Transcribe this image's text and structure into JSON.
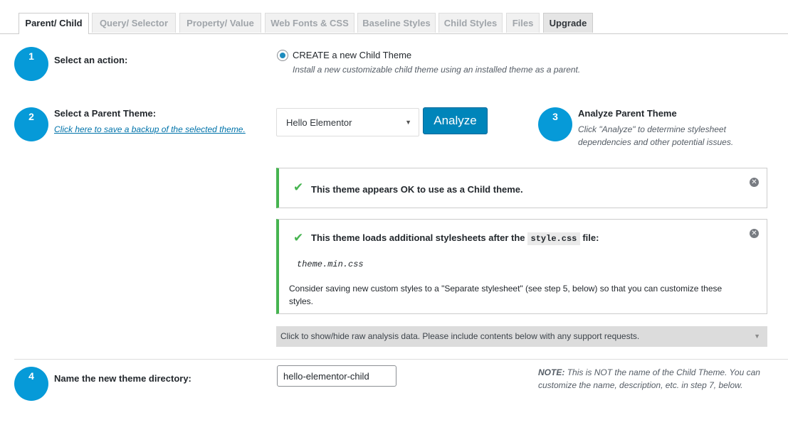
{
  "tabs": [
    {
      "label": "Parent/ Child",
      "active": true
    },
    {
      "label": "Query/ Selector"
    },
    {
      "label": "Property/ Value"
    },
    {
      "label": "Web Fonts & CSS"
    },
    {
      "label": "Baseline Styles"
    },
    {
      "label": "Child Styles"
    },
    {
      "label": "Files"
    },
    {
      "label": "Upgrade"
    }
  ],
  "step1": {
    "number": "1",
    "label": "Select an action:",
    "option_label": "CREATE a new Child Theme",
    "option_desc": "Install a new customizable child theme using an installed theme as a parent."
  },
  "step2": {
    "number": "2",
    "label": "Select a Parent Theme:",
    "backup_link": "Click here to save a backup of the selected theme.",
    "selected_theme": "Hello Elementor",
    "analyze_button": "Analyze"
  },
  "step3": {
    "number": "3",
    "label": "Analyze Parent Theme",
    "desc": "Click \"Analyze\" to determine stylesheet dependencies and other potential issues."
  },
  "notice1": {
    "text": "This theme appears OK to use as a Child theme."
  },
  "notice2": {
    "text_before": "This theme loads additional stylesheets after the",
    "code": "style.css",
    "text_after": "file:",
    "file": "theme.min.css",
    "advice": "Consider saving new custom styles to a \"Separate stylesheet\" (see step 5, below) so that you can customize these styles."
  },
  "raw_toggle": "Click to show/hide raw analysis data. Please include contents below with any support requests.",
  "step4": {
    "number": "4",
    "label": "Name the new theme directory:",
    "value": "hello-elementor-child",
    "note_label": "NOTE:",
    "note_text": "This is NOT the name of the Child Theme. You can customize the name, description, etc. in step 7, below."
  },
  "colors": {
    "accent": "#069ad8",
    "button": "#0085ba",
    "success": "#46b450"
  },
  "icons": {
    "check": "checkmark-icon",
    "dismiss": "dismiss-icon",
    "caret": "caret-down-icon"
  }
}
